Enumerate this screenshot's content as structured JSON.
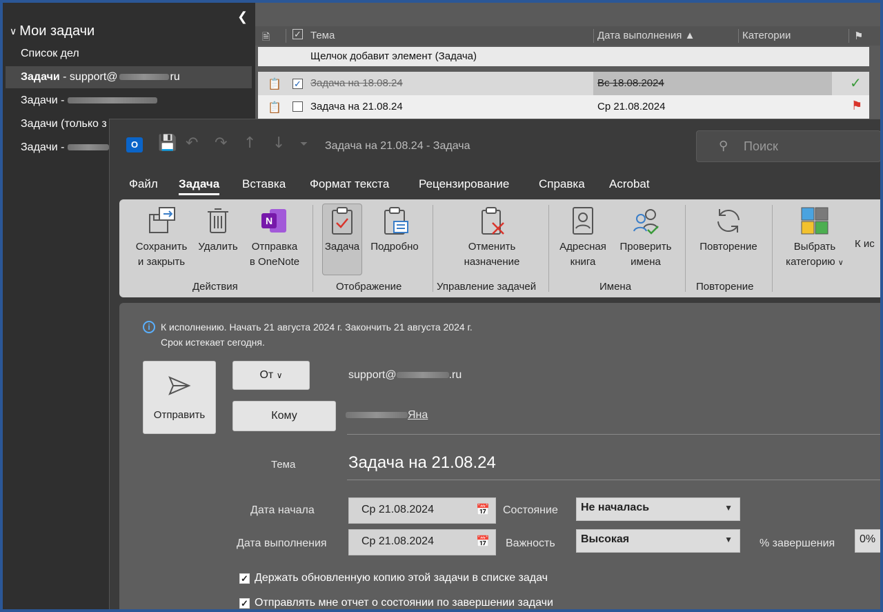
{
  "sidebar": {
    "header": "Мои задачи",
    "items": [
      {
        "label": "Список дел"
      },
      {
        "prefix": "Задачи",
        "label": " - support@",
        "suffix": "ru"
      },
      {
        "label": "Задачи -"
      },
      {
        "label": "Задачи (только з"
      },
      {
        "label": "Задачи -"
      }
    ]
  },
  "tasklist": {
    "columns": {
      "subject": "Тема",
      "due": "Дата выполнения",
      "categories": "Категории"
    },
    "add_row": "Щелчок добавит элемент (Задача)",
    "rows": [
      {
        "subject": "Задача на 18.08.24",
        "due": "Вс 18.08.2024",
        "done": true,
        "status_icon": "checkmark-icon"
      },
      {
        "subject": "Задача на 21.08.24",
        "due": "Ср 21.08.2024",
        "done": false,
        "status_icon": "red-flag-icon"
      }
    ]
  },
  "window": {
    "title": "Задача на 21.08.24  -  Задача",
    "search_placeholder": "Поиск",
    "tabs": [
      "Файл",
      "Задача",
      "Вставка",
      "Формат текста",
      "Рецензирование",
      "Справка",
      "Acrobat"
    ],
    "active_tab": "Задача"
  },
  "ribbon": {
    "save_close_1": "Сохранить",
    "save_close_2": "и закрыть",
    "delete": "Удалить",
    "onenote_1": "Отправка",
    "onenote_2": "в OneNote",
    "group_actions": "Действия",
    "task": "Задача",
    "details": "Подробно",
    "group_display": "Отображение",
    "cancel_assign_1": "Отменить",
    "cancel_assign_2": "назначение",
    "group_manage": "Управление задачей",
    "address_book_1": "Адресная",
    "address_book_2": "книга",
    "check_names_1": "Проверить",
    "check_names_2": "имена",
    "group_names": "Имена",
    "recurrence": "Повторение",
    "group_recurrence": "Повторение",
    "categorize_1": "Выбрать",
    "categorize_2": "категорию",
    "followup": "К ис",
    "colors": {
      "blue": "#4aa3df",
      "gray": "#7a7a7a",
      "yellow": "#f2c12e",
      "green": "#4caf50",
      "onenote": "#7719aa",
      "cancel_red": "#d9342b"
    }
  },
  "form": {
    "info_line1": "К исполнению.  Начать 21 августа 2024 г.  Закончить 21 августа 2024 г.",
    "info_line2": "Срок истекает сегодня.",
    "send": "Отправить",
    "from_btn": "От",
    "from_value_prefix": "support@",
    "from_value_suffix": ".ru",
    "to_btn": "Кому",
    "to_value": "Яна",
    "subject_label": "Тема",
    "subject_value": "Задача на 21.08.24",
    "start_label": "Дата начала",
    "start_value": "Ср 21.08.2024",
    "due_label": "Дата выполнения",
    "due_value": "Ср 21.08.2024",
    "status_label": "Состояние",
    "status_value": "Не началась",
    "priority_label": "Важность",
    "priority_value": "Высокая",
    "percent_label": "% завершения",
    "percent_value": "0%",
    "keep_copy": "Держать обновленную копию этой задачи в списке задач",
    "send_report": "Отправлять мне отчет о состоянии по завершении задачи"
  }
}
